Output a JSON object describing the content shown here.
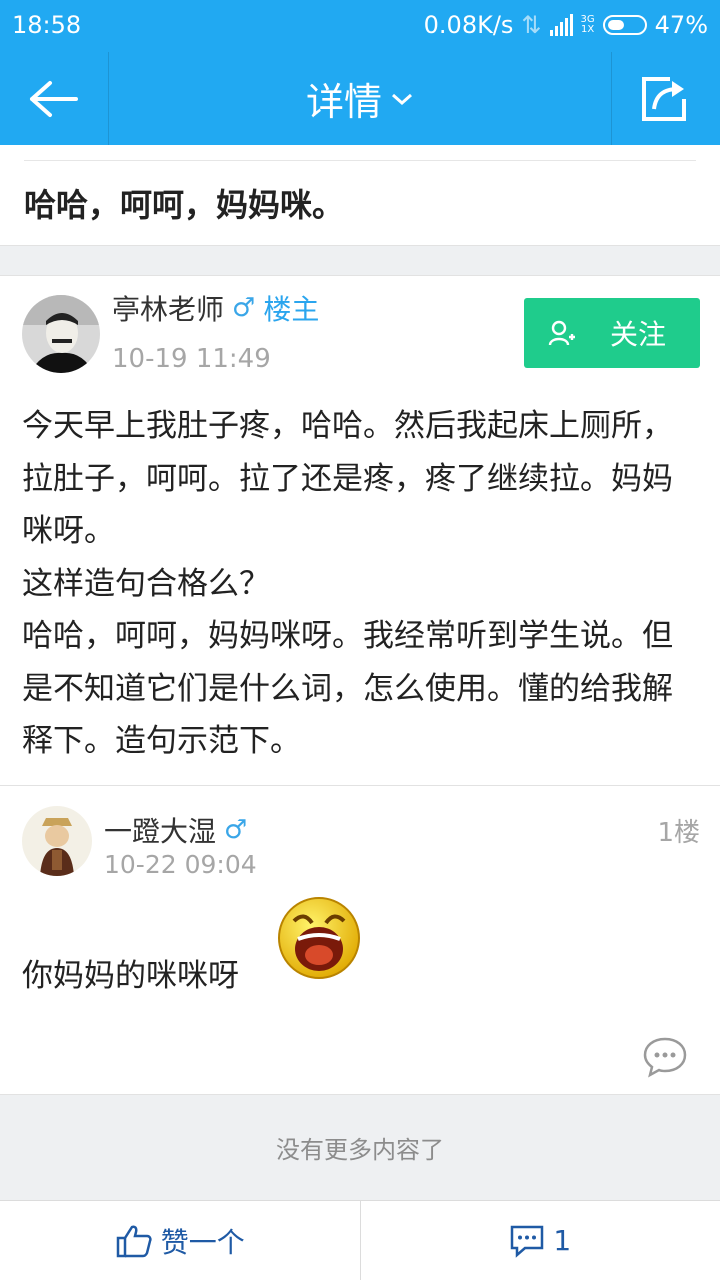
{
  "status_bar": {
    "time": "18:58",
    "speed": "0.08K/s",
    "network_top": "3G",
    "network_bottom": "1X",
    "battery": "47%",
    "battery_level": 0.47
  },
  "app_bar": {
    "title": "详情",
    "back_icon": "arrow-left-icon",
    "dropdown_icon": "chevron-down-icon",
    "share_icon": "share-icon"
  },
  "post": {
    "title": "哈哈，呵呵，妈妈咪。",
    "author": {
      "name": "亭林老师",
      "gender_symbol": "♂",
      "badge": "楼主",
      "time": "10-19 11:49"
    },
    "follow_label": "关注",
    "body": [
      "今天早上我肚子疼，哈哈。然后我起床上厕所，拉肚子，呵呵。拉了还是疼，疼了继续拉。妈妈咪呀。",
      "这样造句合格么？",
      "哈哈，呵呵，妈妈咪呀。我经常听到学生说。但是不知道它们是什么词，怎么使用。懂的给我解释下。造句示范下。"
    ]
  },
  "reply": {
    "author": {
      "name": "一蹬大湿",
      "gender_symbol": "♂",
      "time": "10-22 09:04"
    },
    "floor": "1楼",
    "text": "你妈妈的咪咪呀",
    "emoji": "laughing-face-emoji"
  },
  "footer": {
    "no_more": "没有更多内容了"
  },
  "bottom_bar": {
    "like_label": "赞一个",
    "comment_count": "1"
  },
  "colors": {
    "primary": "#21a9f2",
    "follow": "#1fcc8c",
    "accent_text": "#1f5aa5",
    "muted": "#a6a6a6"
  }
}
